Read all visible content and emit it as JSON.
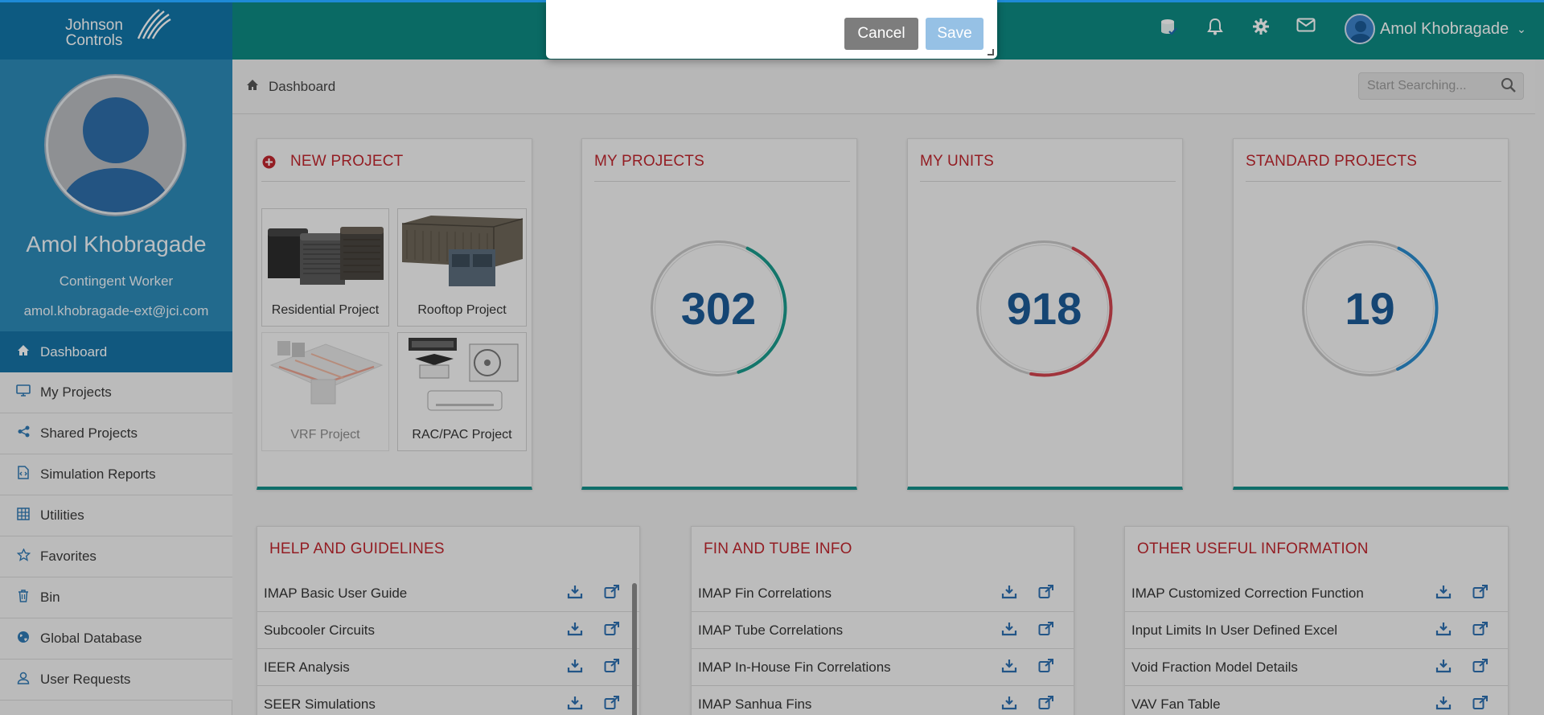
{
  "header": {
    "logo_line1": "Johnson",
    "logo_line2": "Controls",
    "icons": [
      "database-icon",
      "bell-icon",
      "gear-icon",
      "mail-icon"
    ],
    "user_name": "Amol Khobragade"
  },
  "modal": {
    "cancel_label": "Cancel",
    "save_label": "Save"
  },
  "profile": {
    "name": "Amol Khobragade",
    "role": "Contingent Worker",
    "email": "amol.khobragade-ext@jci.com"
  },
  "sidebar": {
    "items": [
      {
        "label": "Dashboard",
        "icon": "home-icon",
        "active": true
      },
      {
        "label": "My Projects",
        "icon": "monitor-icon"
      },
      {
        "label": "Shared Projects",
        "icon": "share-icon"
      },
      {
        "label": "Simulation Reports",
        "icon": "code-file-icon"
      },
      {
        "label": "Utilities",
        "icon": "grid-icon"
      },
      {
        "label": "Favorites",
        "icon": "star-icon"
      },
      {
        "label": "Bin",
        "icon": "trash-icon"
      },
      {
        "label": "Global Database",
        "icon": "globe-icon"
      },
      {
        "label": "User Requests",
        "icon": "user-icon"
      }
    ]
  },
  "breadcrumb": {
    "label": "Dashboard"
  },
  "search": {
    "placeholder": "Start Searching..."
  },
  "cards": {
    "new_project": {
      "title": "NEW PROJECT",
      "tiles": [
        {
          "label": "Residential Project"
        },
        {
          "label": "Rooftop Project"
        },
        {
          "label": "VRF Project",
          "disabled": true
        },
        {
          "label": "RAC/PAC Project"
        }
      ]
    },
    "my_projects": {
      "title": "MY PROJECTS",
      "count": "302",
      "ring_color": "#1a9a8c",
      "ring_fraction": 0.38
    },
    "my_units": {
      "title": "MY UNITS",
      "count": "918",
      "ring_color": "#d0444e",
      "ring_fraction": 0.46
    },
    "standard_projects": {
      "title": "STANDARD PROJECTS",
      "count": "19",
      "ring_color": "#2b8ccd",
      "ring_fraction": 0.36
    }
  },
  "lists": {
    "help": {
      "title": "HELP AND GUIDELINES",
      "items": [
        "IMAP Basic User Guide",
        "Subcooler Circuits",
        "IEER Analysis",
        "SEER Simulations"
      ]
    },
    "fin_tube": {
      "title": "FIN AND TUBE INFO",
      "items": [
        "IMAP Fin Correlations",
        "IMAP Tube Correlations",
        "IMAP In-House Fin Correlations",
        "IMAP Sanhua Fins"
      ]
    },
    "other": {
      "title": "OTHER USEFUL INFORMATION",
      "items": [
        "IMAP Customized Correction Function",
        "Input Limits In User Defined Excel",
        "Void Fraction Model Details",
        "VAV Fan Table"
      ]
    }
  }
}
